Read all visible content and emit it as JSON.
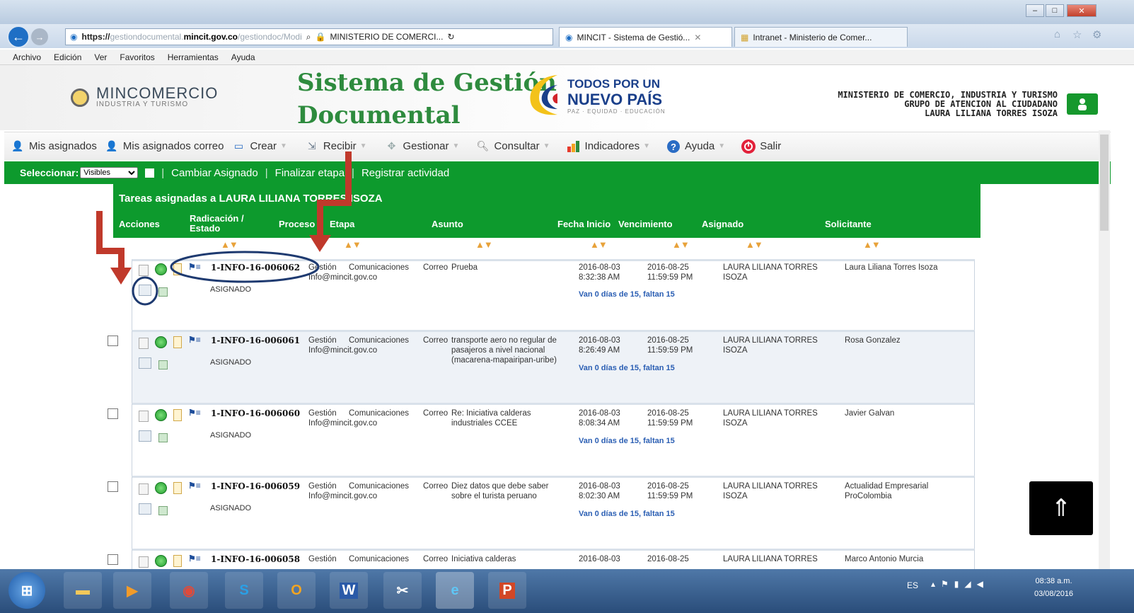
{
  "browser": {
    "url_scheme": "https://",
    "url_host": "gestiondocumental.mincit.gov.co",
    "url_path": "/gestiondoc/Modi",
    "url_site_label": "MINISTERIO DE COMERCI...",
    "tabs": [
      {
        "label": "MINCIT - Sistema de Gestió..."
      },
      {
        "label": "Intranet - Ministerio de Comer..."
      }
    ],
    "menu": [
      "Archivo",
      "Edición",
      "Ver",
      "Favoritos",
      "Herramientas",
      "Ayuda"
    ]
  },
  "header": {
    "logo_name": "MINCOMERCIO",
    "logo_sub": "INDUSTRIA Y TURISMO",
    "title_line1": "Sistema de Gestión",
    "title_line2": "Documental",
    "slogan_l1": "TODOS POR UN",
    "slogan_l2": "NUEVO PAÍS",
    "slogan_l3": "PAZ · EQUIDAD · EDUCACIÓN",
    "ministry_l1": "MINISTERIO DE COMERCIO, INDUSTRIA Y TURISMO",
    "ministry_l2": "GRUPO DE ATENCION AL CIUDADANO",
    "ministry_l3": "LAURA LILIANA TORRES ISOZA"
  },
  "toolbar": {
    "items": [
      "Mis asignados",
      "Mis asignados correo",
      "Crear",
      "Recibir",
      "Gestionar",
      "Consultar",
      "Indicadores",
      "Ayuda",
      "Salir"
    ]
  },
  "greenbar": {
    "select_label": "Seleccionar:",
    "select_value": "Visibles",
    "actions": [
      "Cambiar Asignado",
      "Finalizar etapa",
      "Registrar actividad"
    ]
  },
  "grid": {
    "title": "Tareas asignadas a LAURA LILIANA TORRES ISOZA",
    "headers": {
      "acciones": "Acciones",
      "radicacion_l1": "Radicación /",
      "radicacion_l2": "Estado",
      "proceso": "Proceso",
      "etapa": "Etapa",
      "asunto": "Asunto",
      "fecha_inicio": "Fecha Inicio",
      "vencimiento": "Vencimiento",
      "asignado": "Asignado",
      "solicitante": "Solicitante"
    },
    "sort_glyph": "▲▼",
    "rows": [
      {
        "rad": "1-INFO-16-006062",
        "estado": "ASIGNADO",
        "proceso": "Gestión",
        "etapa_l1": "Comunicaciones",
        "etapa_l2": "Info@mincit.gov.co",
        "asunto_type": "Correo",
        "asunto": "Prueba",
        "inicio_d": "2016-08-03",
        "inicio_t": "8:32:38 AM",
        "venc_d": "2016-08-25",
        "venc_t": "11:59:59 PM",
        "plazo": "Van 0 días de 15, faltan 15",
        "asignado_l1": "LAURA LILIANA TORRES",
        "asignado_l2": "ISOZA",
        "solicitante": "Laura Liliana Torres Isoza"
      },
      {
        "rad": "1-INFO-16-006061",
        "estado": "ASIGNADO",
        "proceso": "Gestión",
        "etapa_l1": "Comunicaciones",
        "etapa_l2": "Info@mincit.gov.co",
        "asunto_type": "Correo",
        "asunto": "transporte aero no regular de pasajeros a nivel nacional (macarena-mapairipan-uribe)",
        "inicio_d": "2016-08-03",
        "inicio_t": "8:26:49 AM",
        "venc_d": "2016-08-25",
        "venc_t": "11:59:59 PM",
        "plazo": "Van 0 días de 15, faltan 15",
        "asignado_l1": "LAURA LILIANA TORRES",
        "asignado_l2": "ISOZA",
        "solicitante": "Rosa Gonzalez"
      },
      {
        "rad": "1-INFO-16-006060",
        "estado": "ASIGNADO",
        "proceso": "Gestión",
        "etapa_l1": "Comunicaciones",
        "etapa_l2": "Info@mincit.gov.co",
        "asunto_type": "Correo",
        "asunto": "Re: Iniciativa calderas industriales CCEE",
        "inicio_d": "2016-08-03",
        "inicio_t": "8:08:34 AM",
        "venc_d": "2016-08-25",
        "venc_t": "11:59:59 PM",
        "plazo": "Van 0 días de 15, faltan 15",
        "asignado_l1": "LAURA LILIANA TORRES",
        "asignado_l2": "ISOZA",
        "solicitante": "Javier Galvan"
      },
      {
        "rad": "1-INFO-16-006059",
        "estado": "ASIGNADO",
        "proceso": "Gestión",
        "etapa_l1": "Comunicaciones",
        "etapa_l2": "Info@mincit.gov.co",
        "asunto_type": "Correo",
        "asunto": "Diez datos que debe saber sobre el turista peruano",
        "inicio_d": "2016-08-03",
        "inicio_t": "8:02:30 AM",
        "venc_d": "2016-08-25",
        "venc_t": "11:59:59 PM",
        "plazo": "Van 0 días de 15, faltan 15",
        "asignado_l1": "LAURA LILIANA TORRES",
        "asignado_l2": "ISOZA",
        "solicitante": "Actualidad Empresarial ProColombia"
      },
      {
        "rad": "1-INFO-16-006058",
        "proceso": "Gestión",
        "etapa_l1": "Comunicaciones",
        "asunto_type": "Correo",
        "asunto": "Iniciativa calderas",
        "inicio_d": "2016-08-03",
        "venc_d": "2016-08-25",
        "asignado_l1": "LAURA LILIANA TORRES",
        "solicitante": "Marco Antonio Murcia"
      }
    ]
  },
  "taskbar": {
    "lang": "ES",
    "time": "08:38 a.m.",
    "date": "03/08/2016"
  },
  "colors": {
    "green": "#0d9a2d",
    "arrow": "#c0392b",
    "circle": "#1e3a70"
  }
}
